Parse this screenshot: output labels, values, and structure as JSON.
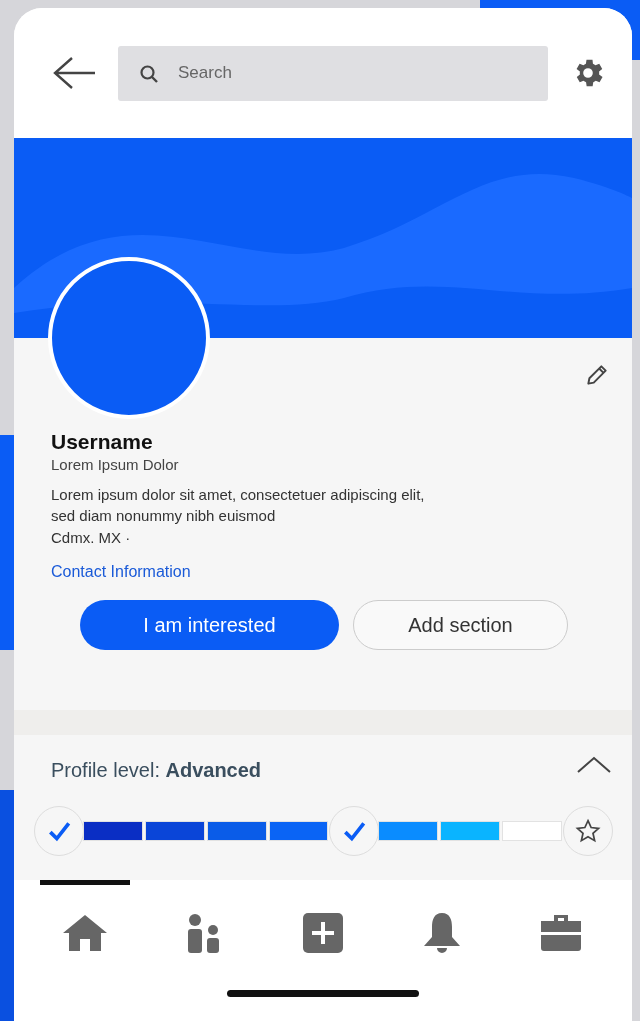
{
  "search": {
    "placeholder": "Search"
  },
  "profile": {
    "name": "Username",
    "subtitle": "Lorem Ipsum Dolor",
    "bio": "Lorem ipsum dolor sit amet, consectetuer adipiscing elit, sed diam nonummy nibh euismod",
    "location": "Cdmx. MX ·",
    "contact_link": "Contact Information"
  },
  "buttons": [
    {
      "label": "I am interested",
      "kind": "primary"
    },
    {
      "label": "Add section",
      "kind": "outline"
    }
  ],
  "profile_level": {
    "label": "Profile level: **Advanced**",
    "expanded": true,
    "track": [
      {
        "kind": "check",
        "checked": true
      },
      {
        "kind": "segment",
        "color": "#0a2ec4"
      },
      {
        "kind": "segment",
        "color": "#0a45d8"
      },
      {
        "kind": "segment",
        "color": "#0a5ce8"
      },
      {
        "kind": "segment",
        "color": "#0a64f5"
      },
      {
        "kind": "check",
        "checked": true
      },
      {
        "kind": "segment",
        "color": "#0a8cff"
      },
      {
        "kind": "segment",
        "color": "#0ab4ff"
      },
      {
        "kind": "segment",
        "color": "#ffffff"
      },
      {
        "kind": "star",
        "checked": false
      }
    ]
  },
  "nav": [
    {
      "kind": "home",
      "selected": true
    },
    {
      "kind": "people",
      "selected": false
    },
    {
      "kind": "add",
      "selected": false
    },
    {
      "kind": "bell",
      "selected": false
    },
    {
      "kind": "briefcase",
      "selected": false
    }
  ]
}
